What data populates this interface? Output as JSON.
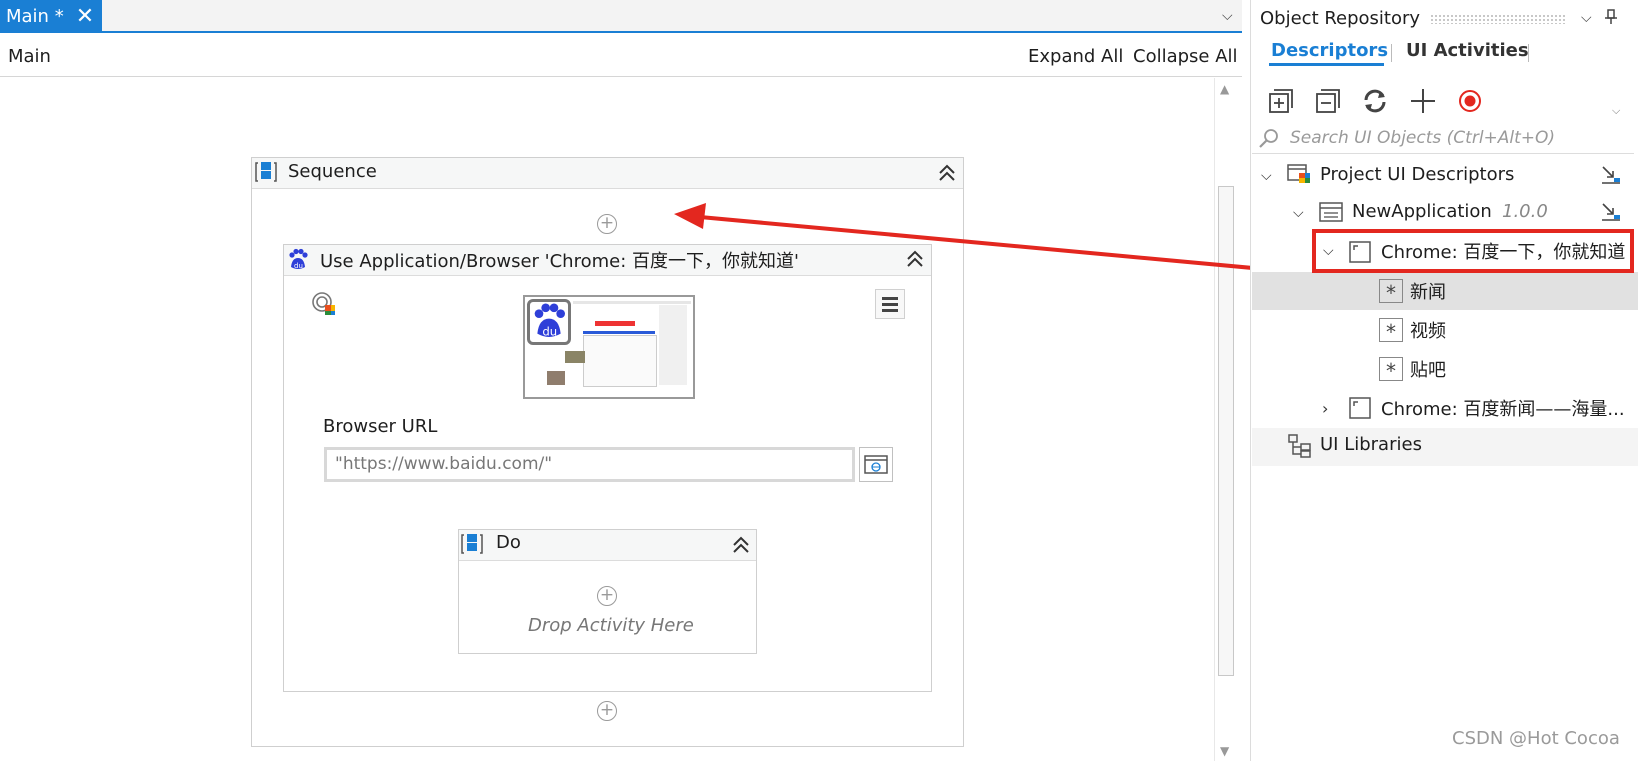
{
  "designer": {
    "tab_label": "Main *",
    "tab_close": "✕",
    "tab_dropdown": "⌵",
    "breadcrumb": "Main",
    "expand_all": "Expand All",
    "collapse_all": "Collapse All"
  },
  "sequence": {
    "title": "Sequence",
    "collapse": "⌃"
  },
  "use_app": {
    "title": "Use Application/Browser 'Chrome: 百度一下，你就知道'",
    "url_label": "Browser URL",
    "url_value": "\"https://www.baidu.com/\""
  },
  "do_block": {
    "title": "Do",
    "drop_hint": "Drop Activity Here"
  },
  "repository": {
    "title": "Object Repository",
    "tabs": [
      "Descriptors",
      "UI Activities"
    ],
    "search_placeholder": "Search UI Objects (Ctrl+Alt+O)",
    "tree": {
      "root": "Project UI Descriptors",
      "app": "NewApplication",
      "app_version": "1.0.0",
      "screen1": "Chrome: 百度一下，你就知道",
      "elements": [
        "新闻",
        "视频",
        "贴吧"
      ],
      "screen2": "Chrome: 百度新闻——海量...",
      "libraries": "UI Libraries"
    }
  },
  "watermark": "CSDN @Hot Cocoa",
  "colors": {
    "accent": "#1a7fd4",
    "highlight": "#e3271f"
  }
}
